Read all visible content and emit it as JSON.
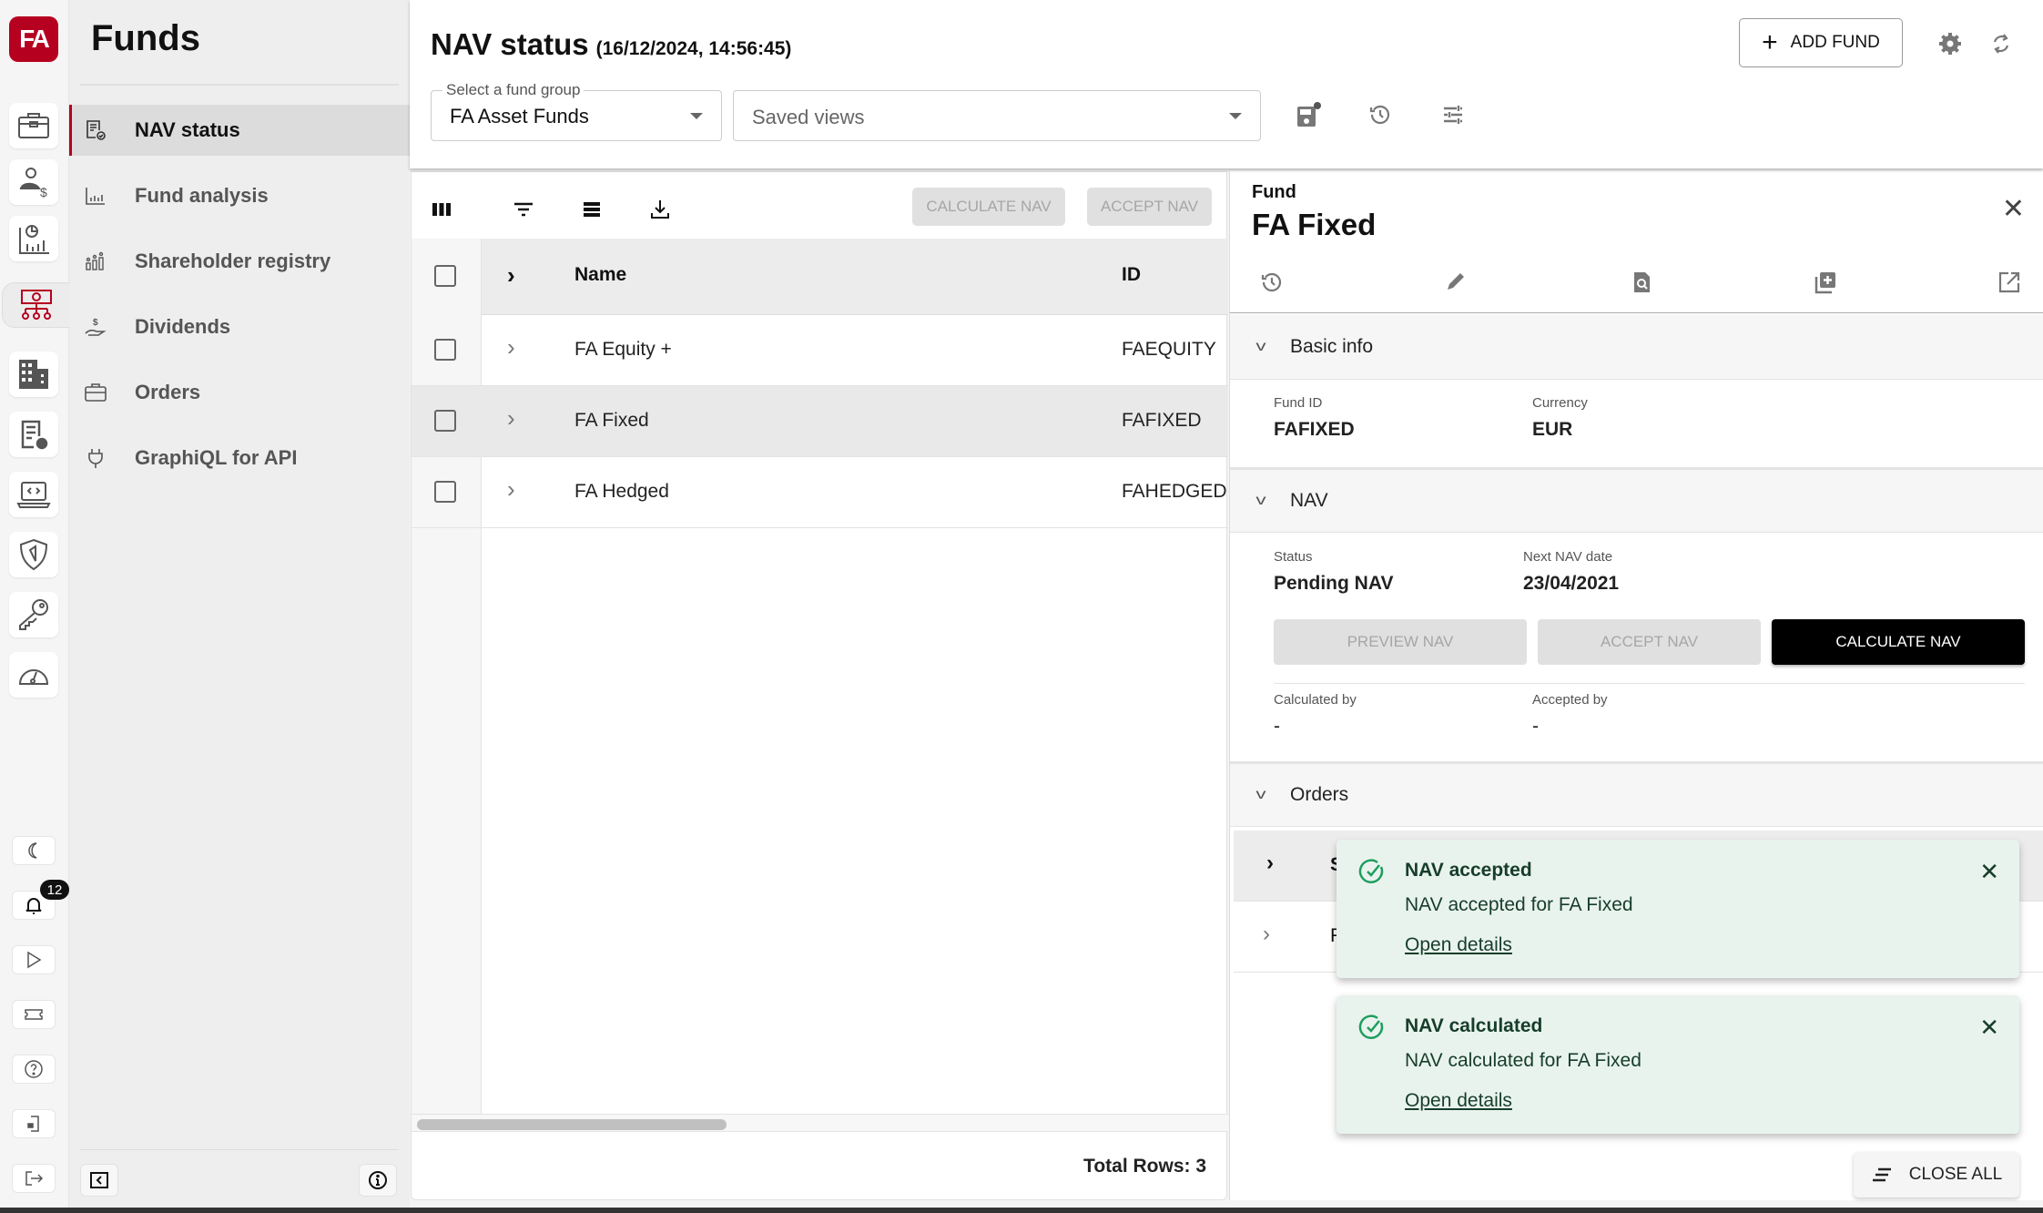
{
  "app": {
    "logo_text": "FA",
    "notification_count": "12"
  },
  "rail": {
    "items": [
      {
        "name": "portfolio"
      },
      {
        "name": "contacts"
      },
      {
        "name": "analytics"
      },
      {
        "name": "funds",
        "active": true
      },
      {
        "name": "companies"
      },
      {
        "name": "settings-report"
      },
      {
        "name": "developer"
      },
      {
        "name": "security"
      },
      {
        "name": "access-keys"
      },
      {
        "name": "dashboard"
      }
    ]
  },
  "navpanel": {
    "title": "Funds",
    "items": [
      {
        "label": "NAV status",
        "active": true
      },
      {
        "label": "Fund analysis"
      },
      {
        "label": "Shareholder registry"
      },
      {
        "label": "Dividends"
      },
      {
        "label": "Orders"
      },
      {
        "label": "GraphiQL for API"
      }
    ]
  },
  "header": {
    "title": "NAV status",
    "timestamp": "(16/12/2024, 14:56:45)",
    "fund_group": {
      "legend": "Select a fund group",
      "value": "FA Asset Funds"
    },
    "saved_views": {
      "placeholder": "Saved views"
    },
    "add_fund_label": "ADD FUND"
  },
  "table": {
    "toolbar": {
      "calculate_nav_label": "CALCULATE NAV",
      "accept_nav_label": "ACCEPT NAV"
    },
    "columns": [
      "Name",
      "ID"
    ],
    "rows": [
      {
        "name": "FA Equity +",
        "id": "FAEQUITY"
      },
      {
        "name": "FA Fixed",
        "id": "FAFIXED",
        "selected": true
      },
      {
        "name": "FA Hedged",
        "id": "FAHEDGED"
      }
    ],
    "total_rows": "Total Rows: 3"
  },
  "detail": {
    "caption": "Fund",
    "title": "FA Fixed",
    "sections": {
      "basic_info": {
        "label": "Basic info",
        "fund_id_label": "Fund ID",
        "fund_id": "FAFIXED",
        "currency_label": "Currency",
        "currency": "EUR"
      },
      "nav": {
        "label": "NAV",
        "status_label": "Status",
        "status": "Pending NAV",
        "next_date_label": "Next NAV date",
        "next_date": "23/04/2021",
        "preview_label": "PREVIEW NAV",
        "accept_label": "ACCEPT NAV",
        "calculate_label": "CALCULATE NAV",
        "calculated_by_label": "Calculated by",
        "calculated_by": "-",
        "accepted_by_label": "Accepted by",
        "accepted_by": "-"
      },
      "orders": {
        "label": "Orders",
        "rows": [
          {
            "partial": "S"
          },
          {
            "partial": "F"
          }
        ]
      }
    }
  },
  "toasts": [
    {
      "title": "NAV accepted",
      "message": "NAV accepted for FA Fixed",
      "link": "Open details"
    },
    {
      "title": "NAV calculated",
      "message": "NAV calculated for FA Fixed",
      "link": "Open details"
    }
  ],
  "close_all_label": "CLOSE ALL",
  "colors": {
    "brand": "#b5001f",
    "success": "#1e9e5e",
    "toast_bg": "#e9f3ee"
  }
}
